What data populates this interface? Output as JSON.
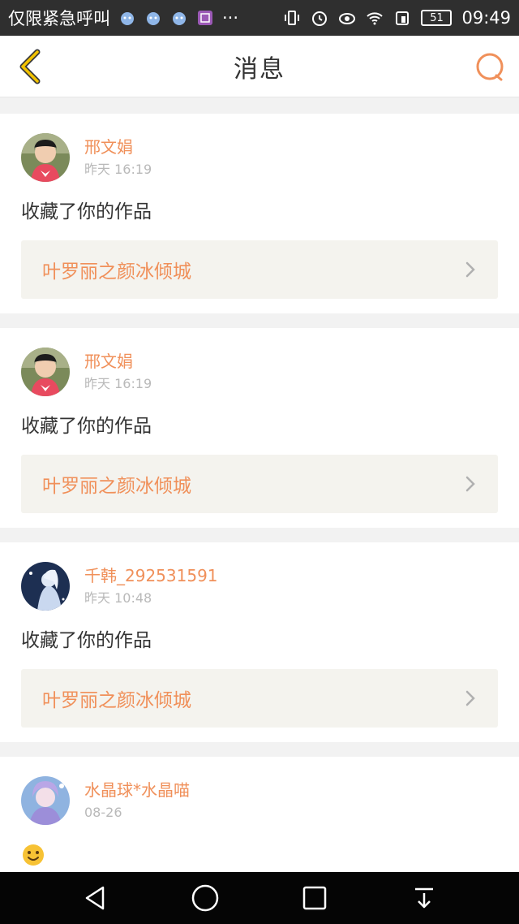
{
  "status_bar": {
    "carrier_text": "仅限紧急呼叫",
    "more": "···",
    "battery": "51",
    "time": "09:49"
  },
  "header": {
    "title": "消息",
    "back_icon": "chevron-left-icon",
    "search_icon": "search-icon"
  },
  "messages": [
    {
      "username": "邢文娟",
      "time": "昨天 16:19",
      "action": "收藏了你的作品",
      "work_title": "叶罗丽之颜冰倾城"
    },
    {
      "username": "邢文娟",
      "time": "昨天 16:19",
      "action": "收藏了你的作品",
      "work_title": "叶罗丽之颜冰倾城"
    },
    {
      "username": "千韩_292531591",
      "time": "昨天 10:48",
      "action": "收藏了你的作品",
      "work_title": "叶罗丽之颜冰倾城"
    },
    {
      "username": "水晶球*水晶喵",
      "time": "08-26"
    }
  ],
  "colors": {
    "accent": "#f0905a",
    "header_back": "#e0b400",
    "link_bg": "#f4f3ee"
  }
}
